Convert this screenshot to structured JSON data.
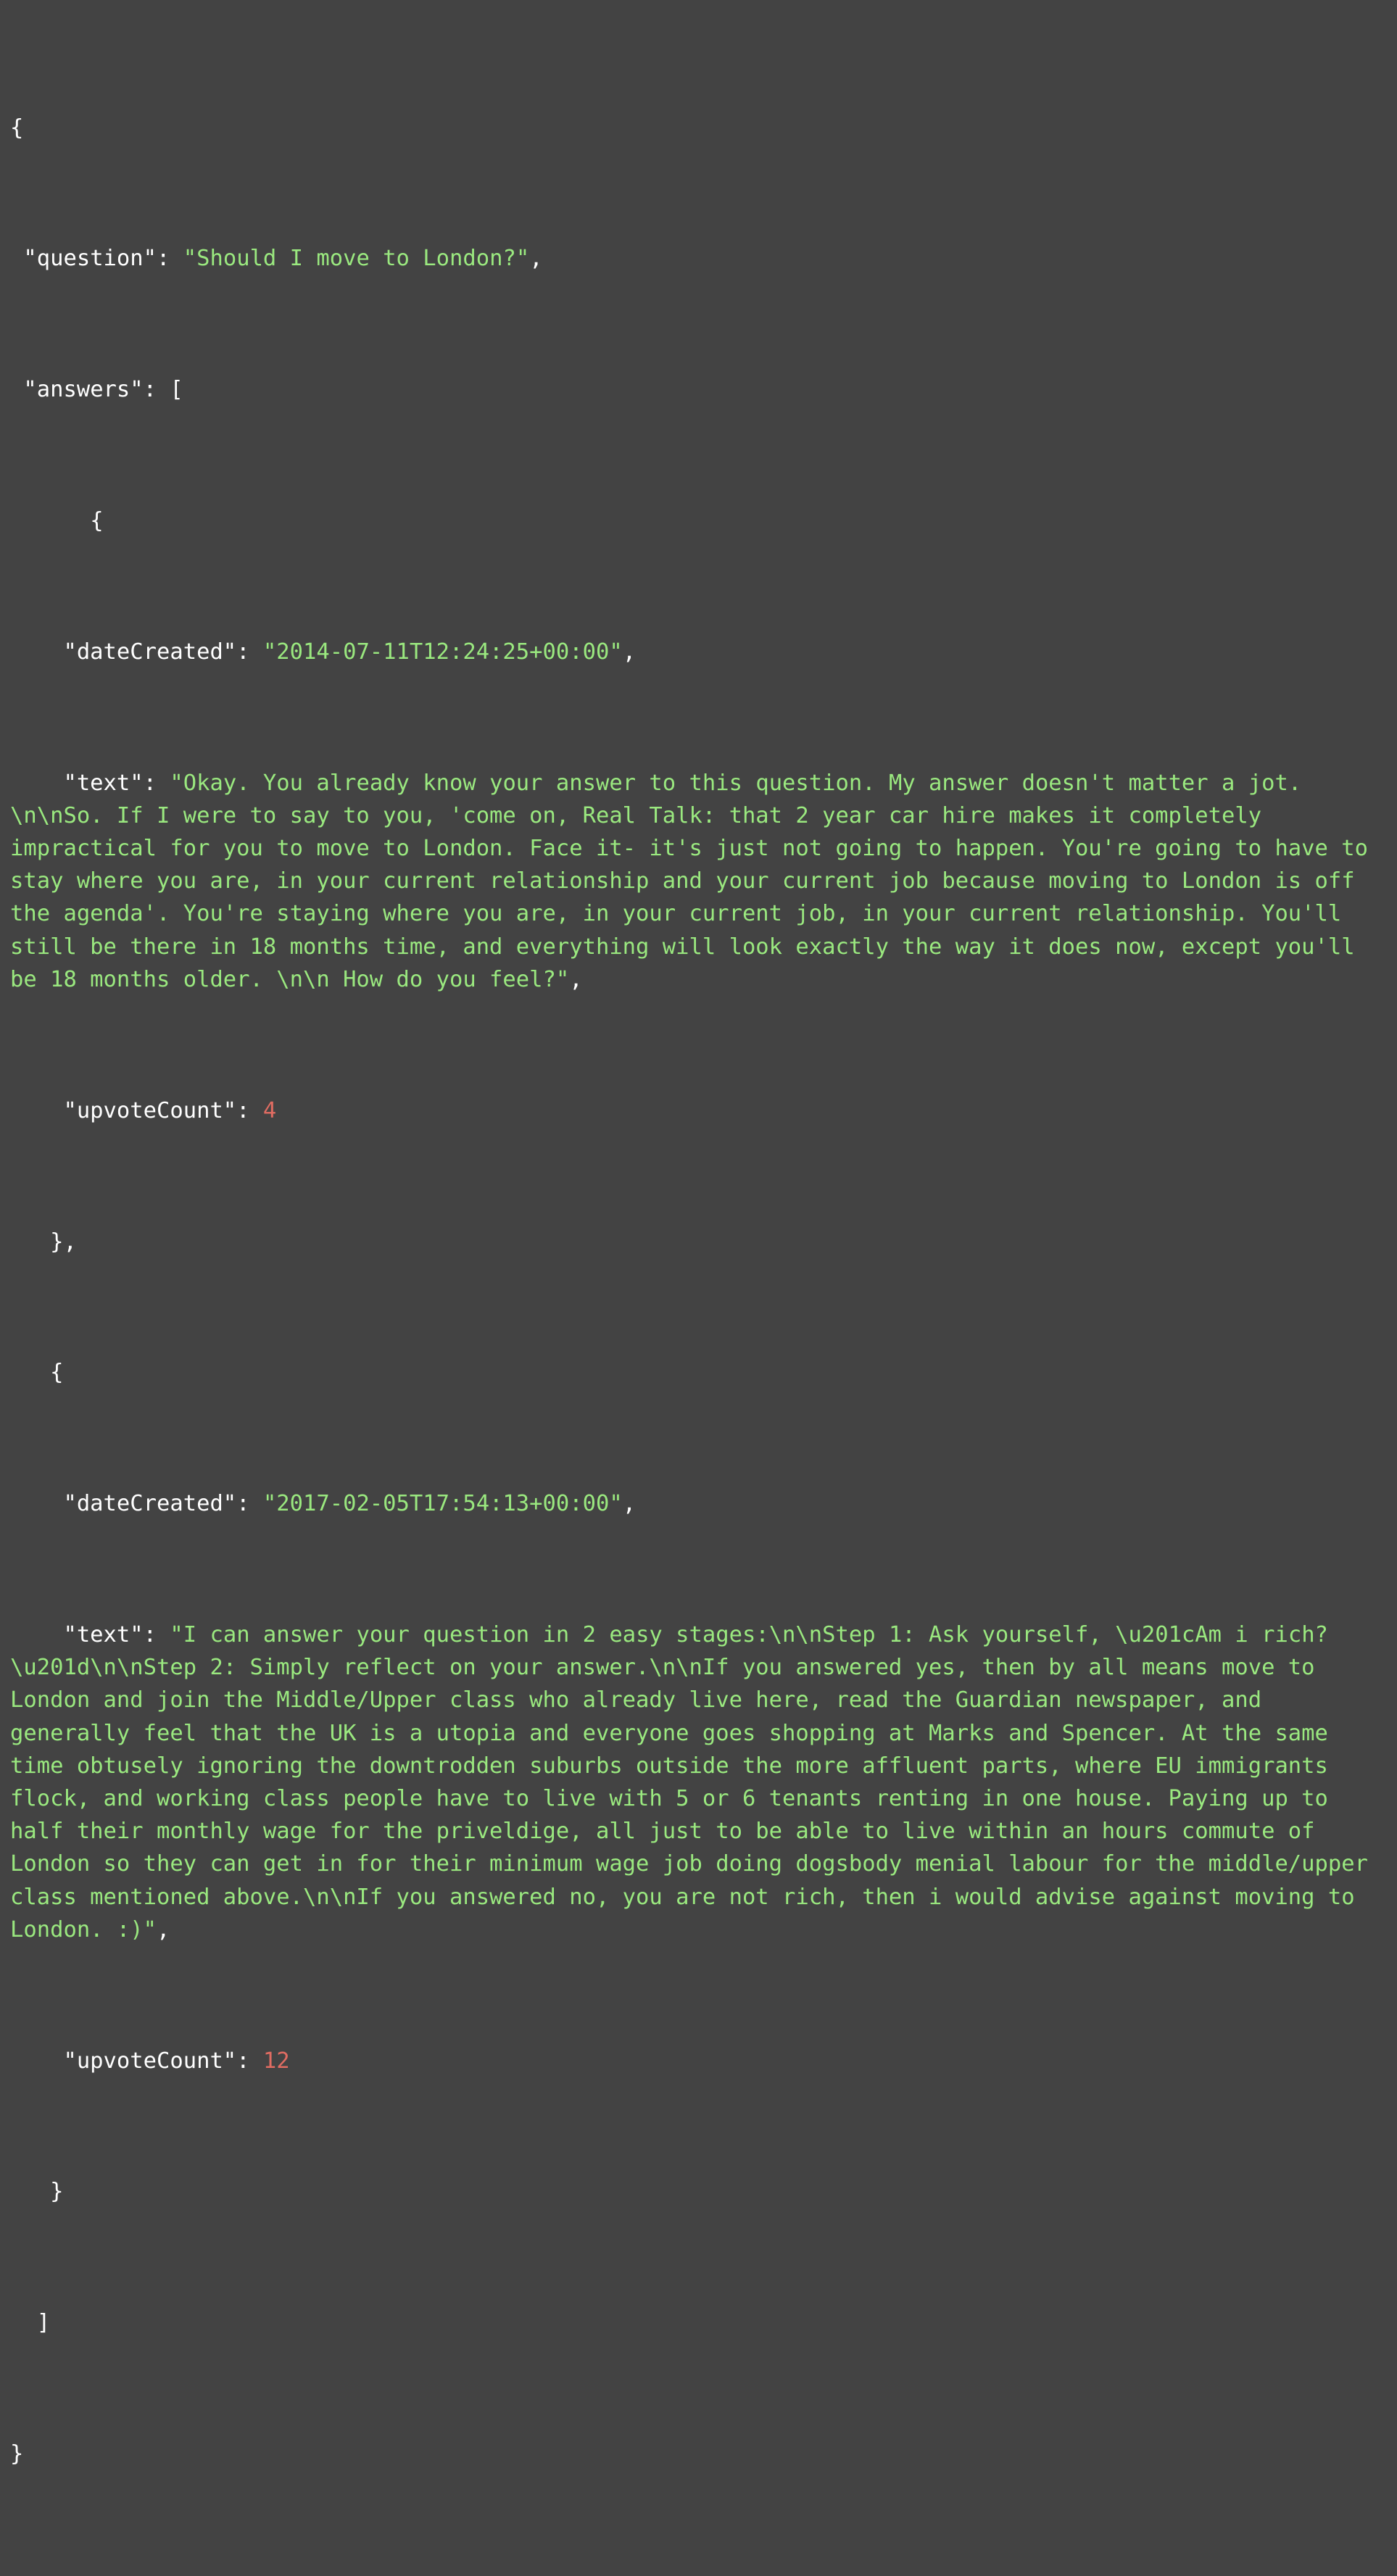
{
  "theme": {
    "background": "#434343",
    "punctuation_color": "#ffffff",
    "key_color": "#ffffff",
    "string_color": "#9ae87f",
    "number_color": "#e06c62"
  },
  "document_type": "json",
  "json": {
    "question_key": "\"question\"",
    "question_value": "\"Should I move to London?\"",
    "answers_key": "\"answers\"",
    "open_brace": "{",
    "close_brace": "}",
    "open_bracket": "[",
    "close_bracket": "]",
    "colon": ": ",
    "comma": ",",
    "brace_comma": "},",
    "answers": [
      {
        "dateCreated_key": "\"dateCreated\"",
        "dateCreated_value": "\"2014-07-11T12:24:25+00:00\"",
        "text_key": "\"text\"",
        "text_value": "\"Okay. You already know your answer to this question. My answer doesn't matter a jot. \\n\\nSo. If I were to say to you, 'come on, Real Talk: that 2 year car hire makes it completely impractical for you to move to London. Face it- it's just not going to happen. You're going to have to stay where you are, in your current relationship and your current job because moving to London is off the agenda'. You're staying where you are, in your current job, in your current relationship. You'll still be there in 18 months time, and everything will look exactly the way it does now, except you'll be 18 months older. \\n\\n How do you feel?\"",
        "upvoteCount_key": "\"upvoteCount\"",
        "upvoteCount_value": "4"
      },
      {
        "dateCreated_key": "\"dateCreated\"",
        "dateCreated_value": "\"2017-02-05T17:54:13+00:00\"",
        "text_key": "\"text\"",
        "text_value": "\"I can answer your question in 2 easy stages:\\n\\nStep 1: Ask yourself, \\u201cAm i rich?\\u201d\\n\\nStep 2: Simply reflect on your answer.\\n\\nIf you answered yes, then by all means move to London and join the Middle/Upper class who already live here, read the Guardian newspaper, and generally feel that the UK is a utopia and everyone goes shopping at Marks and Spencer. At the same time obtusely ignoring the downtrodden suburbs outside the more affluent parts, where EU immigrants flock, and working class people have to live with 5 or 6 tenants renting in one house. Paying up to half their monthly wage for the priveldige, all just to be able to live within an hours commute of London so they can get in for their minimum wage job doing dogsbody menial labour for the middle/upper class mentioned above.\\n\\nIf you answered no, you are not rich, then i would advise against moving to London. :)\"",
        "upvoteCount_key": "\"upvoteCount\"",
        "upvoteCount_value": "12"
      }
    ],
    "indent": {
      "level0": "",
      "level1": " ",
      "level2": "      ",
      "level3": "    ",
      "level_close_obj": "   ",
      "level_close_arr": "  "
    }
  }
}
